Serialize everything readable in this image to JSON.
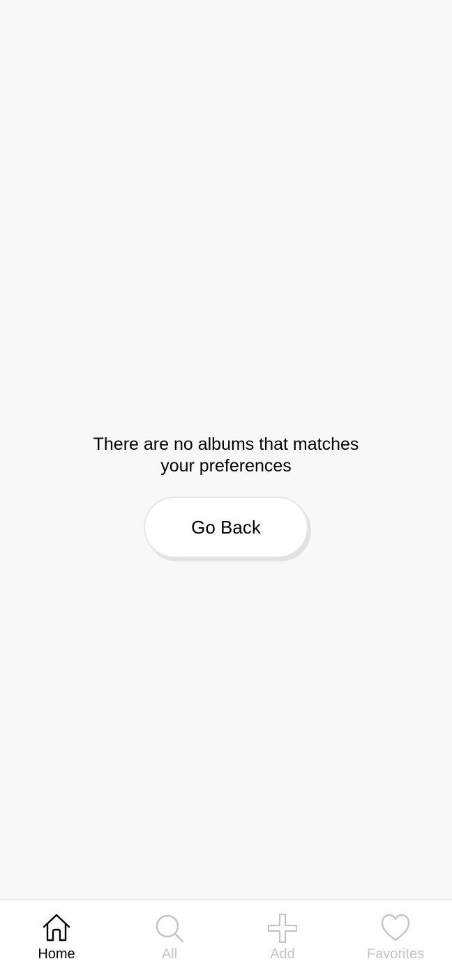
{
  "empty_state": {
    "message_line1": "There are no albums that matches",
    "message_line2": "your preferences",
    "button_label": "Go Back"
  },
  "tabbar": {
    "active_color": "#000000",
    "inactive_color": "#c4c4c4",
    "items": [
      {
        "label": "Home",
        "icon": "home-icon",
        "active": true
      },
      {
        "label": "All",
        "icon": "search-icon",
        "active": false
      },
      {
        "label": "Add",
        "icon": "plus-icon",
        "active": false
      },
      {
        "label": "Favorites",
        "icon": "heart-icon",
        "active": false
      }
    ]
  }
}
